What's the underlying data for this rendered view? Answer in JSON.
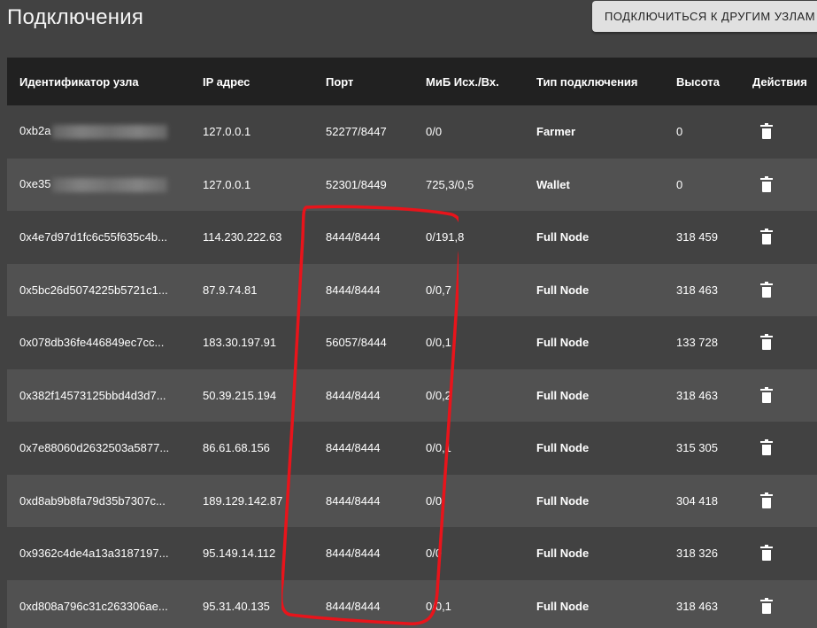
{
  "page_title": "Подключения",
  "connect_button": "ПОДКЛЮЧИТЬСЯ К ДРУГИМ УЗЛАМ",
  "table": {
    "headers": [
      "Идентификатор узла",
      "IP адрес",
      "Порт",
      "МиБ Исх./Вх.",
      "Тип подключения",
      "Высота",
      "Действия"
    ],
    "rows": [
      {
        "id": "0xb2a",
        "id_blurred": true,
        "ip": "127.0.0.1",
        "port": "52277/8447",
        "mib": "0/0",
        "type": "Farmer",
        "height": "0"
      },
      {
        "id": "0xe35",
        "id_blurred": true,
        "ip": "127.0.0.1",
        "port": "52301/8449",
        "mib": "725,3/0,5",
        "type": "Wallet",
        "height": "0"
      },
      {
        "id": "0x4e7d97d1fc6c55f635c4b...",
        "id_blurred": false,
        "ip": "114.230.222.63",
        "port": "8444/8444",
        "mib": "0/191,8",
        "type": "Full Node",
        "height": "318 459"
      },
      {
        "id": "0x5bc26d5074225b5721c1...",
        "id_blurred": false,
        "ip": "87.9.74.81",
        "port": "8444/8444",
        "mib": "0/0,7",
        "type": "Full Node",
        "height": "318 463"
      },
      {
        "id": "0x078db36fe446849ec7cc...",
        "id_blurred": false,
        "ip": "183.30.197.91",
        "port": "56057/8444",
        "mib": "0/0,1",
        "type": "Full Node",
        "height": "133 728"
      },
      {
        "id": "0x382f14573125bbd4d3d7...",
        "id_blurred": false,
        "ip": "50.39.215.194",
        "port": "8444/8444",
        "mib": "0/0,2",
        "type": "Full Node",
        "height": "318 463"
      },
      {
        "id": "0x7e88060d2632503a5877...",
        "id_blurred": false,
        "ip": "86.61.68.156",
        "port": "8444/8444",
        "mib": "0/0,1",
        "type": "Full Node",
        "height": "315 305"
      },
      {
        "id": "0xd8ab9b8fa79d35b7307c...",
        "id_blurred": false,
        "ip": "189.129.142.87",
        "port": "8444/8444",
        "mib": "0/0",
        "type": "Full Node",
        "height": "304 418"
      },
      {
        "id": "0x9362c4de4a13a3187197...",
        "id_blurred": false,
        "ip": "95.149.14.112",
        "port": "8444/8444",
        "mib": "0/0",
        "type": "Full Node",
        "height": "318 326"
      },
      {
        "id": "0xd808a796c31c263306ae...",
        "id_blurred": false,
        "ip": "95.31.40.135",
        "port": "8444/8444",
        "mib": "0/0,1",
        "type": "Full Node",
        "height": "318 463"
      }
    ],
    "action_icon": "trash-icon"
  },
  "colors": {
    "background": "#424242",
    "header_bg": "#212121",
    "row_alt": "#515151",
    "button_bg": "#e0e0e0",
    "annotation": "#e8141b"
  }
}
